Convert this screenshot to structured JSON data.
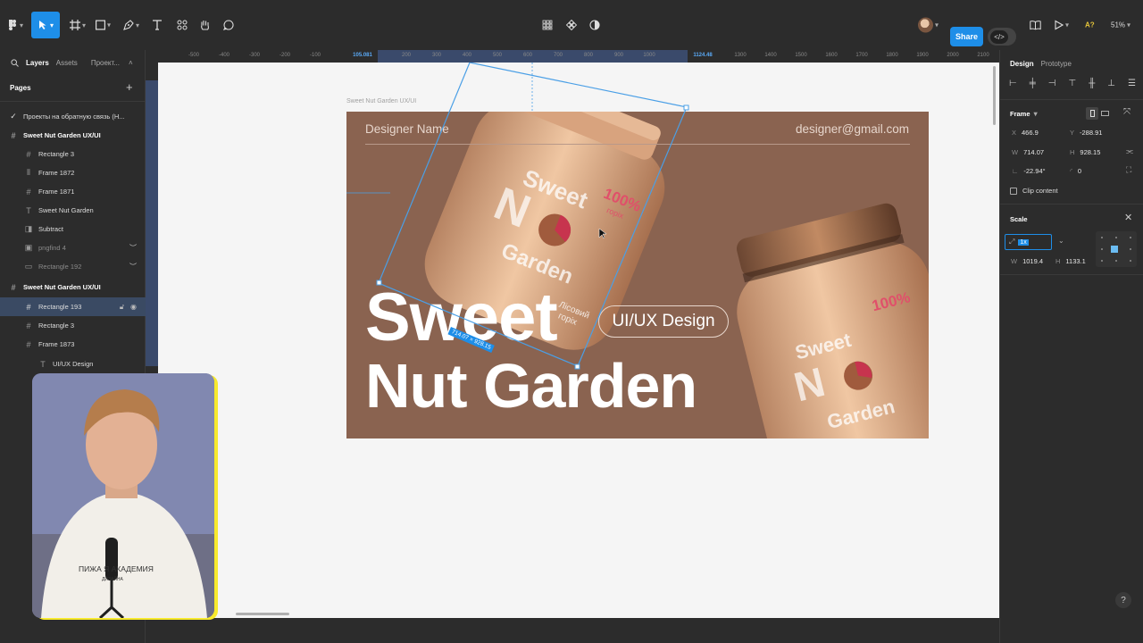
{
  "toolbar": {
    "share_label": "Share",
    "dev_mode_label": "</>",
    "font_badge": "A?",
    "zoom": "51%"
  },
  "left_panel": {
    "tabs": [
      "Layers",
      "Assets",
      "Проект..."
    ],
    "pages_title": "Pages",
    "pages_add": "+",
    "layers": [
      {
        "label": "Проекты на обратную связь (Н...",
        "icon": "check-icon"
      },
      {
        "label": "Sweet Nut Garden UX/UI",
        "icon": "frame-icon"
      },
      {
        "label": "Rectangle 3",
        "icon": "frame-icon"
      },
      {
        "label": "Frame 1872",
        "icon": "autolayout-icon"
      },
      {
        "label": "Frame 1871",
        "icon": "frame-icon"
      },
      {
        "label": "Sweet Nut Garden",
        "icon": "text-icon"
      },
      {
        "label": "Subtract",
        "icon": "boolean-icon"
      },
      {
        "label": "pngfind 4",
        "icon": "image-icon"
      },
      {
        "label": "Rectangle 192",
        "icon": "rect-icon"
      },
      {
        "label": "Sweet Nut Garden UX/UI",
        "icon": "frame-icon"
      },
      {
        "label": "Rectangle 193",
        "icon": "frame-icon"
      },
      {
        "label": "Rectangle 3",
        "icon": "frame-icon"
      },
      {
        "label": "Frame 1873",
        "icon": "frame-icon"
      },
      {
        "label": "UI/UX Design",
        "icon": "text-icon"
      }
    ]
  },
  "rulers": {
    "top_ticks": [
      "-500",
      "-400",
      "-300",
      "-200",
      "-100",
      "105.081",
      "200",
      "300",
      "400",
      "500",
      "600",
      "700",
      "800",
      "900",
      "1000",
      "1124.48",
      "1300",
      "1400",
      "1500",
      "1600",
      "1700",
      "1800",
      "1900",
      "2000",
      "2100"
    ]
  },
  "canvas": {
    "frame_label": "Sweet Nut Garden UX/UI",
    "banner": {
      "designer": "Designer Name",
      "email": "designer@gmail.com",
      "title_line1": "Sweet",
      "title_line2": "Nut Garden",
      "pill": "UI/UX Design"
    },
    "selection_size": "714.07 × 928.15",
    "jar_text": {
      "brand1": "Sweet",
      "brand2": "Garden",
      "percent": "100%",
      "sub": "горіх",
      "flavor1": "Лісовий",
      "flavor2": "горіх"
    }
  },
  "right_panel": {
    "tabs": [
      "Design",
      "Prototype"
    ],
    "frame_title": "Frame",
    "x": {
      "label": "X",
      "value": "466.9"
    },
    "y": {
      "label": "Y",
      "value": "-288.91"
    },
    "w": {
      "label": "W",
      "value": "714.07"
    },
    "h": {
      "label": "H",
      "value": "928.15"
    },
    "rotation": {
      "value": "-22.94°"
    },
    "radius": {
      "value": "0"
    },
    "clip_content": "Clip content",
    "scale_title": "Scale",
    "scale_value": "1x",
    "scale_w": {
      "label": "W",
      "value": "1019.4"
    },
    "scale_h": {
      "label": "H",
      "value": "1133.1"
    }
  },
  "help": "?"
}
